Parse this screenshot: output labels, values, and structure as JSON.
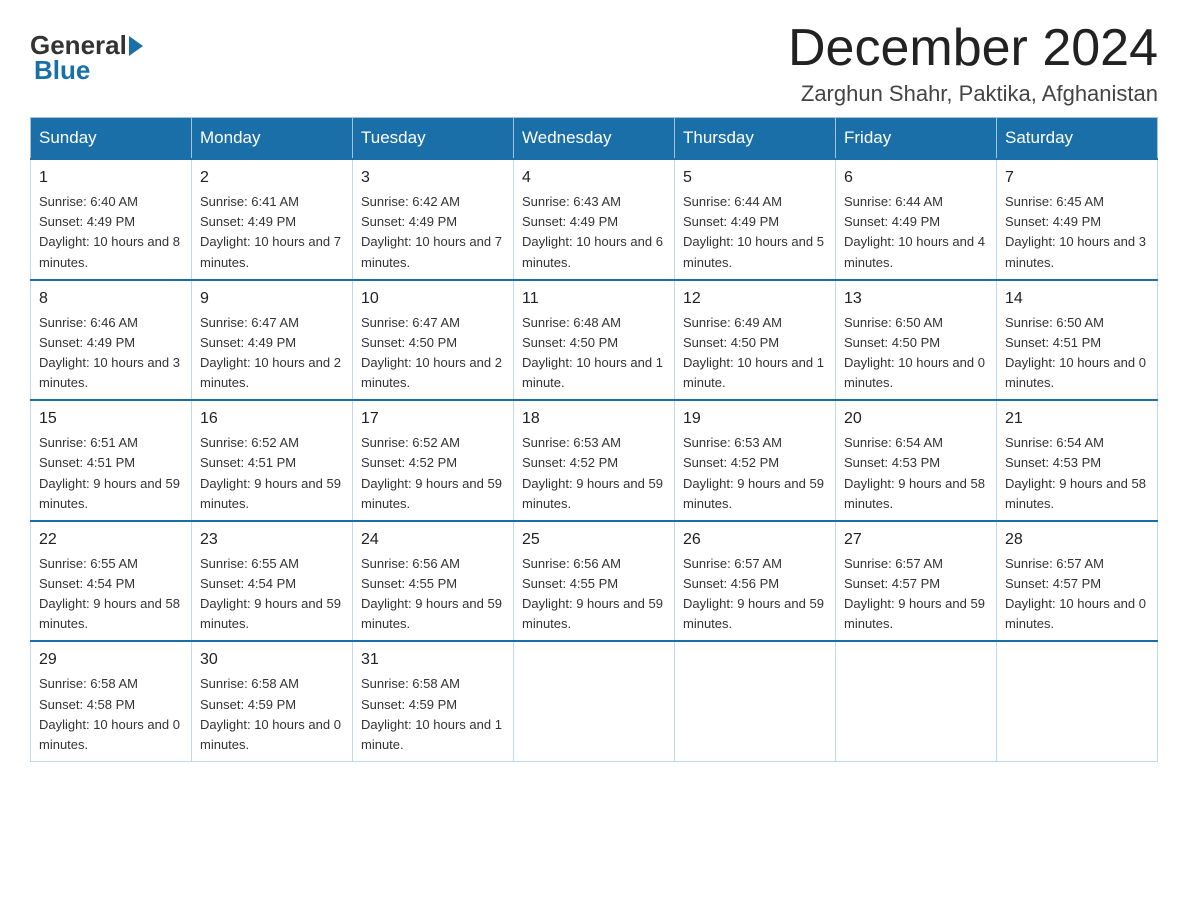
{
  "header": {
    "logo_general": "General",
    "logo_blue": "Blue",
    "month_title": "December 2024",
    "location": "Zarghun Shahr, Paktika, Afghanistan"
  },
  "weekdays": [
    "Sunday",
    "Monday",
    "Tuesday",
    "Wednesday",
    "Thursday",
    "Friday",
    "Saturday"
  ],
  "weeks": [
    [
      {
        "day": "1",
        "sunrise": "6:40 AM",
        "sunset": "4:49 PM",
        "daylight": "10 hours and 8 minutes."
      },
      {
        "day": "2",
        "sunrise": "6:41 AM",
        "sunset": "4:49 PM",
        "daylight": "10 hours and 7 minutes."
      },
      {
        "day": "3",
        "sunrise": "6:42 AM",
        "sunset": "4:49 PM",
        "daylight": "10 hours and 7 minutes."
      },
      {
        "day": "4",
        "sunrise": "6:43 AM",
        "sunset": "4:49 PM",
        "daylight": "10 hours and 6 minutes."
      },
      {
        "day": "5",
        "sunrise": "6:44 AM",
        "sunset": "4:49 PM",
        "daylight": "10 hours and 5 minutes."
      },
      {
        "day": "6",
        "sunrise": "6:44 AM",
        "sunset": "4:49 PM",
        "daylight": "10 hours and 4 minutes."
      },
      {
        "day": "7",
        "sunrise": "6:45 AM",
        "sunset": "4:49 PM",
        "daylight": "10 hours and 3 minutes."
      }
    ],
    [
      {
        "day": "8",
        "sunrise": "6:46 AM",
        "sunset": "4:49 PM",
        "daylight": "10 hours and 3 minutes."
      },
      {
        "day": "9",
        "sunrise": "6:47 AM",
        "sunset": "4:49 PM",
        "daylight": "10 hours and 2 minutes."
      },
      {
        "day": "10",
        "sunrise": "6:47 AM",
        "sunset": "4:50 PM",
        "daylight": "10 hours and 2 minutes."
      },
      {
        "day": "11",
        "sunrise": "6:48 AM",
        "sunset": "4:50 PM",
        "daylight": "10 hours and 1 minute."
      },
      {
        "day": "12",
        "sunrise": "6:49 AM",
        "sunset": "4:50 PM",
        "daylight": "10 hours and 1 minute."
      },
      {
        "day": "13",
        "sunrise": "6:50 AM",
        "sunset": "4:50 PM",
        "daylight": "10 hours and 0 minutes."
      },
      {
        "day": "14",
        "sunrise": "6:50 AM",
        "sunset": "4:51 PM",
        "daylight": "10 hours and 0 minutes."
      }
    ],
    [
      {
        "day": "15",
        "sunrise": "6:51 AM",
        "sunset": "4:51 PM",
        "daylight": "9 hours and 59 minutes."
      },
      {
        "day": "16",
        "sunrise": "6:52 AM",
        "sunset": "4:51 PM",
        "daylight": "9 hours and 59 minutes."
      },
      {
        "day": "17",
        "sunrise": "6:52 AM",
        "sunset": "4:52 PM",
        "daylight": "9 hours and 59 minutes."
      },
      {
        "day": "18",
        "sunrise": "6:53 AM",
        "sunset": "4:52 PM",
        "daylight": "9 hours and 59 minutes."
      },
      {
        "day": "19",
        "sunrise": "6:53 AM",
        "sunset": "4:52 PM",
        "daylight": "9 hours and 59 minutes."
      },
      {
        "day": "20",
        "sunrise": "6:54 AM",
        "sunset": "4:53 PM",
        "daylight": "9 hours and 58 minutes."
      },
      {
        "day": "21",
        "sunrise": "6:54 AM",
        "sunset": "4:53 PM",
        "daylight": "9 hours and 58 minutes."
      }
    ],
    [
      {
        "day": "22",
        "sunrise": "6:55 AM",
        "sunset": "4:54 PM",
        "daylight": "9 hours and 58 minutes."
      },
      {
        "day": "23",
        "sunrise": "6:55 AM",
        "sunset": "4:54 PM",
        "daylight": "9 hours and 59 minutes."
      },
      {
        "day": "24",
        "sunrise": "6:56 AM",
        "sunset": "4:55 PM",
        "daylight": "9 hours and 59 minutes."
      },
      {
        "day": "25",
        "sunrise": "6:56 AM",
        "sunset": "4:55 PM",
        "daylight": "9 hours and 59 minutes."
      },
      {
        "day": "26",
        "sunrise": "6:57 AM",
        "sunset": "4:56 PM",
        "daylight": "9 hours and 59 minutes."
      },
      {
        "day": "27",
        "sunrise": "6:57 AM",
        "sunset": "4:57 PM",
        "daylight": "9 hours and 59 minutes."
      },
      {
        "day": "28",
        "sunrise": "6:57 AM",
        "sunset": "4:57 PM",
        "daylight": "10 hours and 0 minutes."
      }
    ],
    [
      {
        "day": "29",
        "sunrise": "6:58 AM",
        "sunset": "4:58 PM",
        "daylight": "10 hours and 0 minutes."
      },
      {
        "day": "30",
        "sunrise": "6:58 AM",
        "sunset": "4:59 PM",
        "daylight": "10 hours and 0 minutes."
      },
      {
        "day": "31",
        "sunrise": "6:58 AM",
        "sunset": "4:59 PM",
        "daylight": "10 hours and 1 minute."
      },
      null,
      null,
      null,
      null
    ]
  ]
}
